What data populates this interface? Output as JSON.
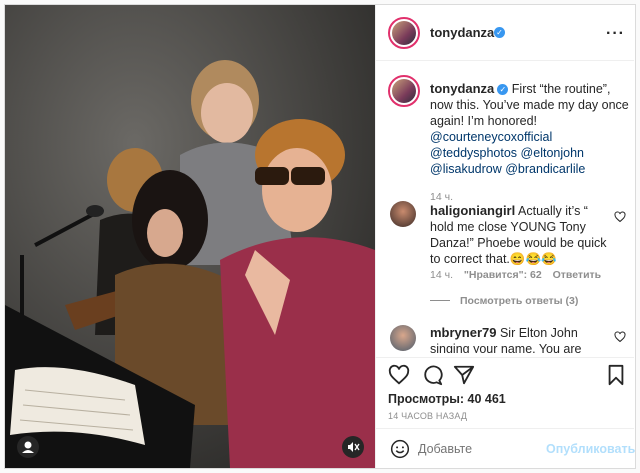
{
  "post": {
    "username": "tonydanza",
    "caption": {
      "text": "First “the routine”, now this. You’ve made my day once again! I’m honored!",
      "mentions": [
        "@courteneycoxofficial",
        "@teddysphotos",
        "@eltonjohn",
        "@lisakudrow",
        "@brandicarlile"
      ],
      "time": "14 ч."
    },
    "comments": [
      {
        "username": "haligoniangirl",
        "text": "Actually it’s “ hold me close YOUNG Tony Danza!” Phoebe would be quick to correct that.😄😂😂",
        "time": "14 ч.",
        "likes": "\"Нравится\": 62",
        "reply": "Ответить",
        "view_replies": "Посмотреть ответы (3)"
      },
      {
        "username": "mbryner79",
        "text": "Sir Elton John singing your name. You are legend, Mr"
      }
    ],
    "views": "Просмотры: 40 461",
    "timestamp": "14 ЧАСОВ НАЗАД",
    "comment_placeholder": "Добавьте",
    "publish_label": "Опубликовать"
  },
  "icons": {
    "more": "more-options-icon",
    "like": "heart-icon",
    "comment": "comment-icon",
    "share": "share-icon",
    "save": "bookmark-icon",
    "emoji": "emoji-icon",
    "mute": "speaker-muted-icon",
    "user": "user-tag-icon"
  },
  "colors": {
    "link": "#00376b",
    "verified": "#3897f0",
    "publish_disabled": "#b2dffc"
  }
}
